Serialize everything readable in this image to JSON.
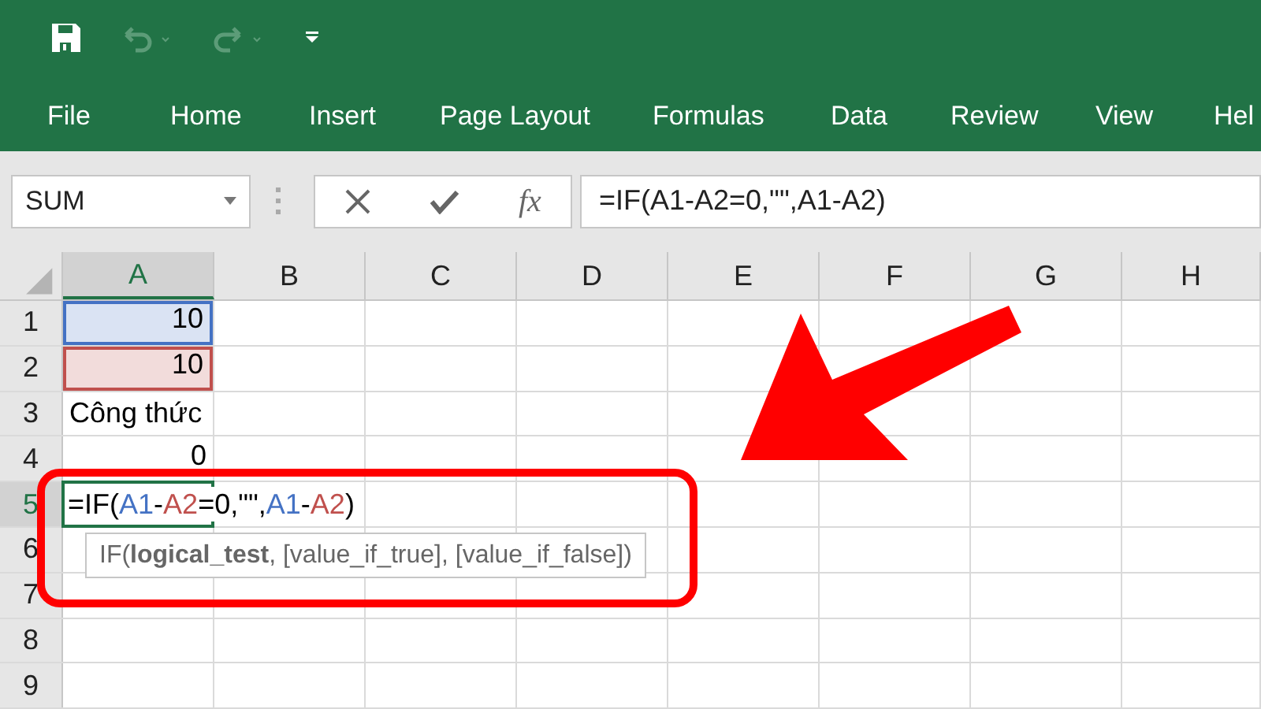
{
  "quick_access": [
    {
      "kind": "save",
      "disabled": false
    },
    {
      "kind": "undo",
      "disabled": true
    },
    {
      "kind": "redo",
      "disabled": true
    },
    {
      "kind": "customize",
      "disabled": false
    }
  ],
  "ribbon_tabs": [
    "File",
    "Home",
    "Insert",
    "Page Layout",
    "Formulas",
    "Data",
    "Review",
    "View",
    "Hel"
  ],
  "name_box": "SUM",
  "function_button": "fx",
  "formula_bar": "=IF(A1-A2=0,\"\",A1-A2)",
  "columns": [
    {
      "label": "A",
      "selected": true
    },
    {
      "label": "B",
      "selected": false
    },
    {
      "label": "C",
      "selected": false
    },
    {
      "label": "D",
      "selected": false
    },
    {
      "label": "E",
      "selected": false
    },
    {
      "label": "F",
      "selected": false
    },
    {
      "label": "G",
      "selected": false
    },
    {
      "label": "H",
      "selected": false
    }
  ],
  "rows": [
    {
      "label": "1",
      "selected": false,
      "cell_a": {
        "value": "10",
        "color": "#4472c4"
      }
    },
    {
      "label": "2",
      "selected": false,
      "cell_a": {
        "value": "10",
        "color": "#c0504d"
      }
    },
    {
      "label": "3",
      "selected": false,
      "cell_a": {
        "value": "Công thức",
        "kind": "text"
      }
    },
    {
      "label": "4",
      "selected": false,
      "cell_a": {
        "value": "0"
      }
    },
    {
      "label": "5",
      "selected": true,
      "editing": true
    },
    {
      "label": "6",
      "selected": false
    },
    {
      "label": "7",
      "selected": false
    },
    {
      "label": "8",
      "selected": false
    },
    {
      "label": "9",
      "selected": false
    }
  ],
  "cell_edit": {
    "segments": [
      {
        "text": "=IF(",
        "color": "#000000"
      },
      {
        "text": "A1",
        "color": "#4472c4"
      },
      {
        "text": "-",
        "color": "#000000"
      },
      {
        "text": "A2",
        "color": "#c0504d"
      },
      {
        "text": "=0,\"\",",
        "color": "#000000"
      },
      {
        "text": "A1",
        "color": "#4472c4"
      },
      {
        "text": "-",
        "color": "#000000"
      },
      {
        "text": "A2",
        "color": "#c0504d"
      },
      {
        "text": ")",
        "color": "#000000"
      }
    ],
    "tooltip": "IF(**logical_test**, [value_if_true], [value_if_false])"
  }
}
